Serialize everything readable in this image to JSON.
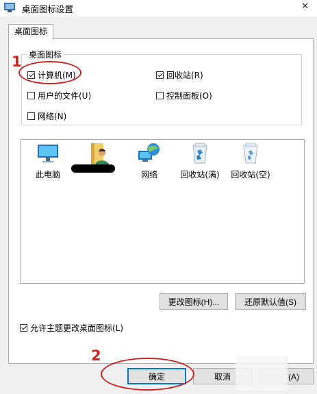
{
  "window": {
    "title": "桌面图标设置"
  },
  "tabs": [
    {
      "label": "桌面图标"
    }
  ],
  "group": {
    "legend": "桌面图标",
    "checkboxes": [
      {
        "label": "计算机(M)",
        "checked": true
      },
      {
        "label": "回收站(R)",
        "checked": true
      },
      {
        "label": "用户的文件(U)",
        "checked": false
      },
      {
        "label": "控制面板(O)",
        "checked": false
      },
      {
        "label": "网络(N)",
        "checked": false
      }
    ]
  },
  "icons": [
    {
      "label": "此电脑",
      "icon": "computer-icon"
    },
    {
      "label": "",
      "icon": "user-folder-icon"
    },
    {
      "label": "网络",
      "icon": "network-icon"
    },
    {
      "label": "回收站(满)",
      "icon": "recycle-bin-full-icon"
    },
    {
      "label": "回收站(空)",
      "icon": "recycle-bin-empty-icon"
    }
  ],
  "buttons": {
    "change_icon": "更改图标(H)...",
    "restore_default": "还原默认值(S)",
    "ok": "确定",
    "cancel": "取消",
    "apply": "(A)"
  },
  "allow_theme": {
    "label": "允许主题更改桌面图标(L)",
    "checked": true
  },
  "annotations": {
    "step1": "1",
    "step2": "2",
    "color": "#d0251f"
  }
}
